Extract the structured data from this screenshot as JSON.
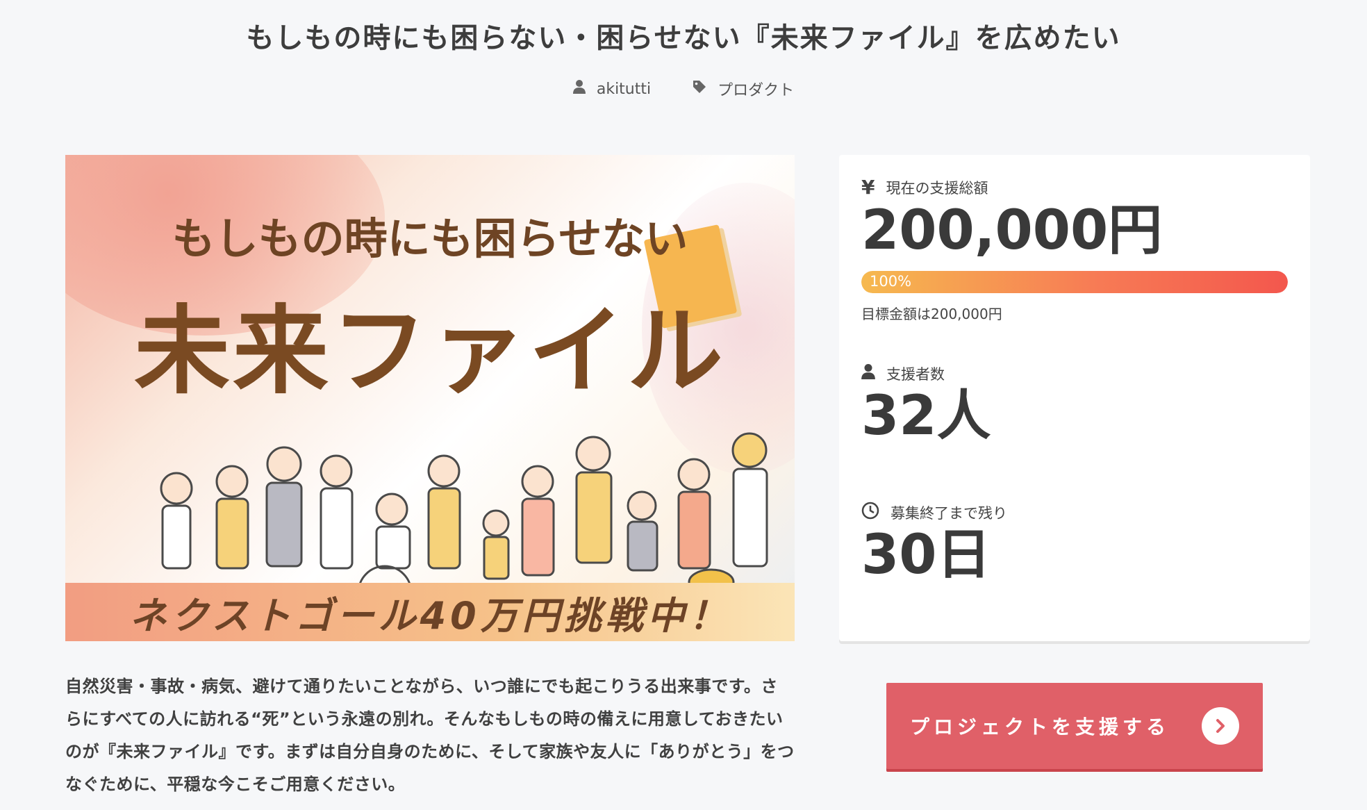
{
  "page": {
    "title": "もしもの時にも困らない・困らせない『未来ファイル』を広めたい",
    "author": "akitutti",
    "category": "プロダクト"
  },
  "hero": {
    "subtitle": "もしもの時にも困らせない",
    "headline": "未来ファイル",
    "banner": "ネクストゴール40万円挑戦中！"
  },
  "stats": {
    "amount_label": "現在の支援総額",
    "amount_value": "200,000円",
    "progress_percent": 100,
    "progress_text": "100%",
    "goal_text": "目標金額は200,000円",
    "backers_label": "支援者数",
    "backers_value": "32人",
    "remaining_label": "募集終了まで残り",
    "remaining_value": "30日"
  },
  "description": {
    "text": "自然災害・事故・病気、避けて通りたいことながら、いつ誰にでも起こりうる出来事です。さらにすべての人に訪れる“死”という永遠の別れ。そんなもしもの時の備えに用意しておきたいのが『未来ファイル』です。まずは自分自身のために、そして家族や友人に「ありがとう」をつなぐために、平穏な今こそご用意ください。"
  },
  "cta": {
    "label": "プロジェクトを支援する"
  },
  "colors": {
    "accent": "#e06068",
    "progress_start": "#f6b94f",
    "progress_end": "#f3574d"
  }
}
